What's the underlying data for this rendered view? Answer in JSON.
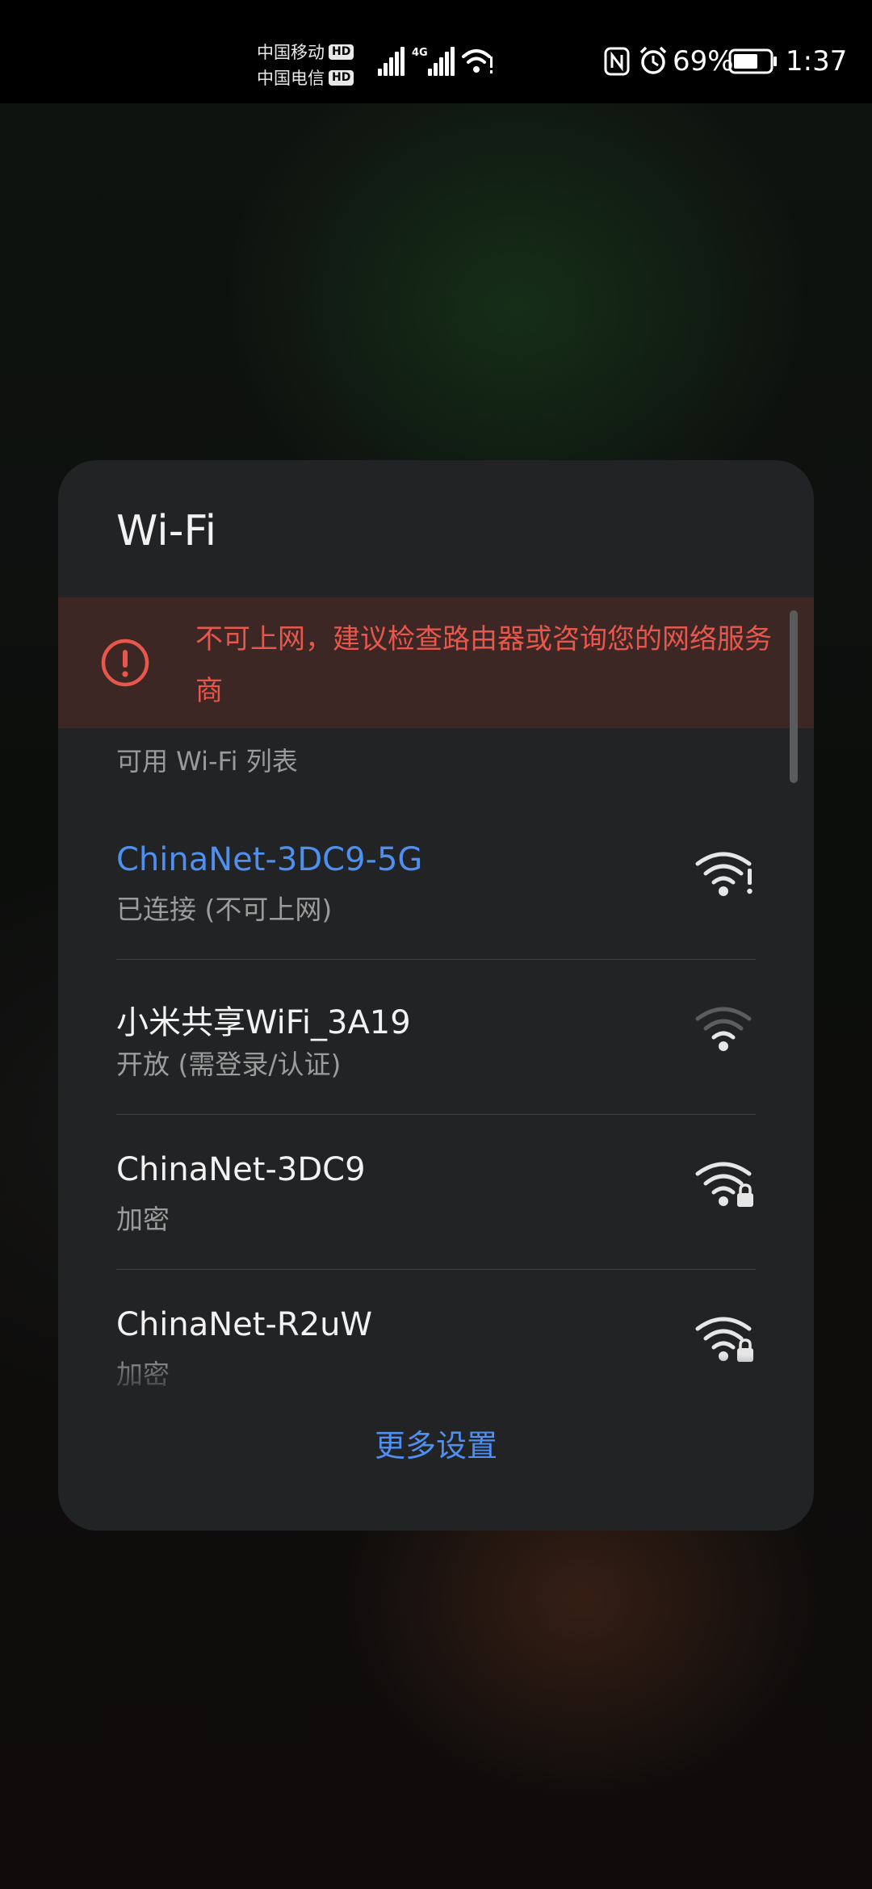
{
  "status_bar": {
    "carrier_1": "中国移动",
    "carrier_2": "中国电信",
    "hd_badge": "HD",
    "network_type": "4G",
    "battery_percent": "69%",
    "time": "1:37",
    "icons": [
      "nfc-icon",
      "alarm-icon",
      "battery-icon",
      "wifi-status-icon",
      "signal-icon"
    ]
  },
  "panel": {
    "title": "Wi-Fi",
    "warning": {
      "text": "不可上网，建议检查路由器或咨询您的网络服务商",
      "icon": "alert-circle-icon",
      "color": "#e8574c"
    },
    "section_label": "可用 Wi-Fi 列表",
    "networks": [
      {
        "name": "ChinaNet-3DC9-5G",
        "status": "已连接 (不可上网)",
        "connected": true,
        "icon": "wifi-warning-icon"
      },
      {
        "name": " 小米共享WiFi_3A19",
        "status": "开放 (需登录/认证)",
        "connected": false,
        "icon": "wifi-weak-icon"
      },
      {
        "name": "ChinaNet-3DC9",
        "status": "加密",
        "connected": false,
        "icon": "wifi-lock-icon"
      },
      {
        "name": "ChinaNet-R2uW",
        "status": "加密",
        "connected": false,
        "icon": "wifi-lock-icon"
      }
    ],
    "more_settings": "更多设置",
    "accent_color": "#4f8ff0"
  }
}
